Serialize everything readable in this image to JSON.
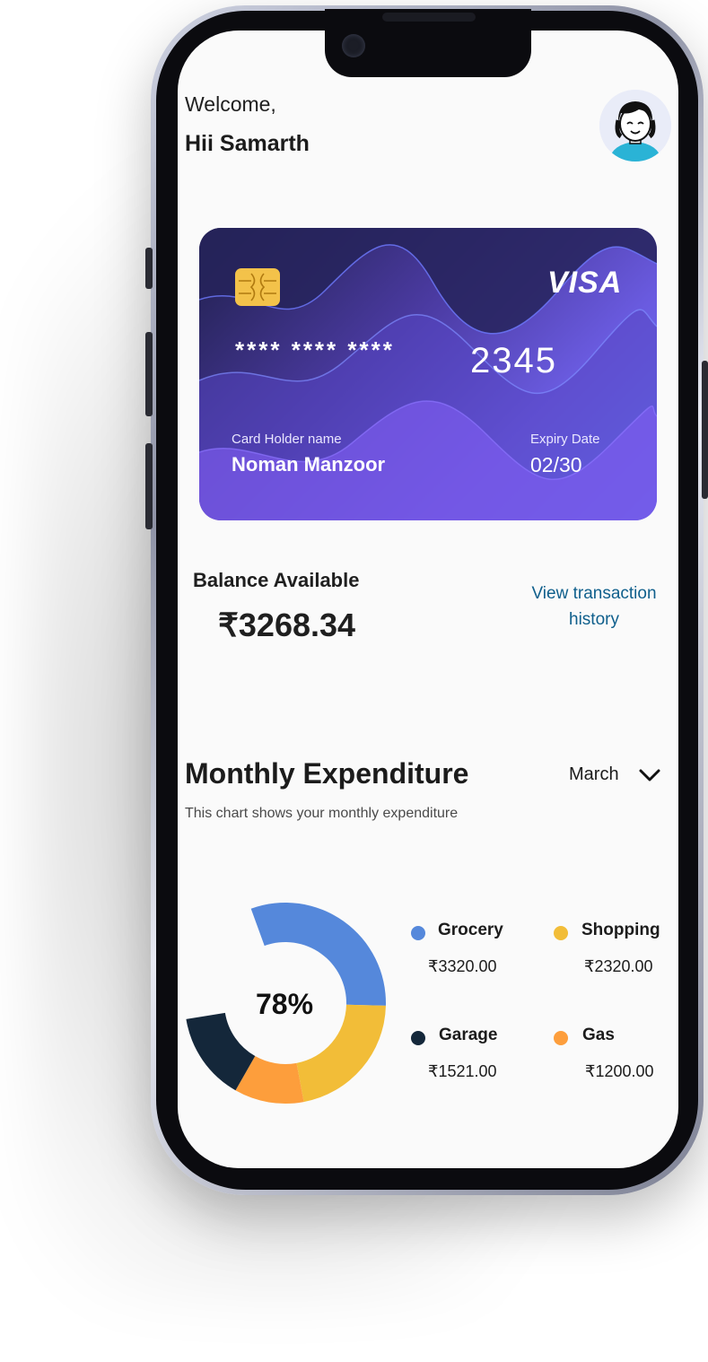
{
  "header": {
    "welcome": "Welcome,",
    "greeting": "Hii  Samarth"
  },
  "card": {
    "brand": "VISA",
    "number_masked": "**** **** ****",
    "number_last4": "2345",
    "holder_label": "Card Holder name",
    "holder_name": "Noman Manzoor",
    "expiry_label": "Expiry Date",
    "expiry_value": "02/30"
  },
  "balance": {
    "label": "Balance Available",
    "value": "₹3268.34",
    "link_line1": "View transaction",
    "link_line2": "history"
  },
  "expenditure": {
    "title": "Monthly Expenditure",
    "subtitle": "This chart shows your monthly expenditure",
    "month": "March"
  },
  "chart_data": {
    "type": "pie",
    "center_label": "78%",
    "categories": [
      "Grocery",
      "Shopping",
      "Garage",
      "Gas"
    ],
    "values": [
      3320.0,
      2320.0,
      1521.0,
      1200.0
    ],
    "value_labels": [
      "₹3320.00",
      "₹2320.00",
      "₹1521.00",
      "₹1200.00"
    ],
    "colors": [
      "#5588db",
      "#f2bd38",
      "#14273a",
      "#fd9e3c"
    ],
    "filled_fraction": 0.78
  }
}
